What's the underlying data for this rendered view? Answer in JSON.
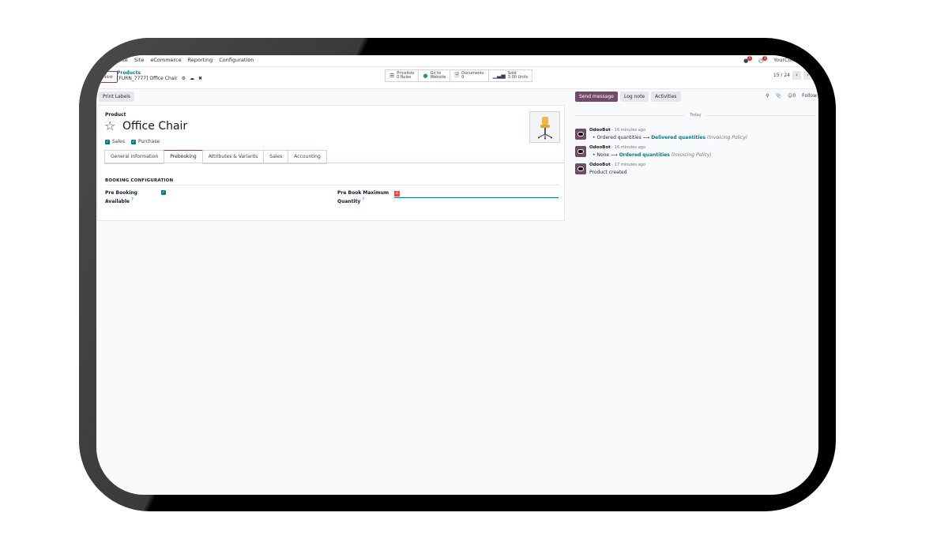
{
  "navbar": {
    "app_partial": "ebsite",
    "menu": [
      "Site",
      "eCommerce",
      "Reporting",
      "Configuration"
    ],
    "chat_badge": "5",
    "activity_badge": "3",
    "company": "YourCompa"
  },
  "control": {
    "new_label": "New",
    "breadcrumb_parent": "Products",
    "breadcrumb_current": "[FURN_7777] Office Chair",
    "smart_buttons": [
      {
        "icon": "list-icon",
        "line1": "Pricelists",
        "line2": "0 Rules"
      },
      {
        "icon": "globe-icon",
        "line1": "Go to",
        "line2": "Website"
      },
      {
        "icon": "document-icon",
        "line1": "Documents",
        "line2": "0"
      },
      {
        "icon": "bar-chart-icon",
        "line1": "Sold",
        "line2": "3.00 Units"
      }
    ],
    "pager": "15 / 24"
  },
  "form": {
    "print_labels": "Print Labels",
    "product_label": "Product",
    "product_name": "Office Chair",
    "sales_label": "Sales",
    "purchase_label": "Purchase",
    "tabs": [
      "General Information",
      "Prebooking",
      "Attributes & Variants",
      "Sales",
      "Accounting"
    ],
    "active_tab": "Prebooking",
    "section_title": "BOOKING CONFIGURATION",
    "pre_booking_label1": "Pre Booking",
    "pre_booking_label2": "Available",
    "max_qty_label1": "Pre Book Maximum",
    "max_qty_label2": "Quantity",
    "help_mark": "?"
  },
  "chatter": {
    "send_message": "Send message",
    "log_note": "Log note",
    "activities": "Activities",
    "follow": "Follow",
    "followers_count": "0",
    "day_label": "Today",
    "messages": [
      {
        "author": "OdooBot",
        "time": "- 16 minutes ago",
        "old": "Ordered quantities",
        "new": "Delivered quantities",
        "field": "(Invoicing Policy)"
      },
      {
        "author": "OdooBot",
        "time": "- 16 minutes ago",
        "old": "None",
        "new": "Ordered quantities",
        "field": "(Invoicing Policy)"
      },
      {
        "author": "OdooBot",
        "time": "- 17 minutes ago",
        "text": "Product created"
      }
    ]
  },
  "colors": {
    "brand": "#714b67",
    "accent": "#017e84",
    "danger": "#dc2626"
  }
}
